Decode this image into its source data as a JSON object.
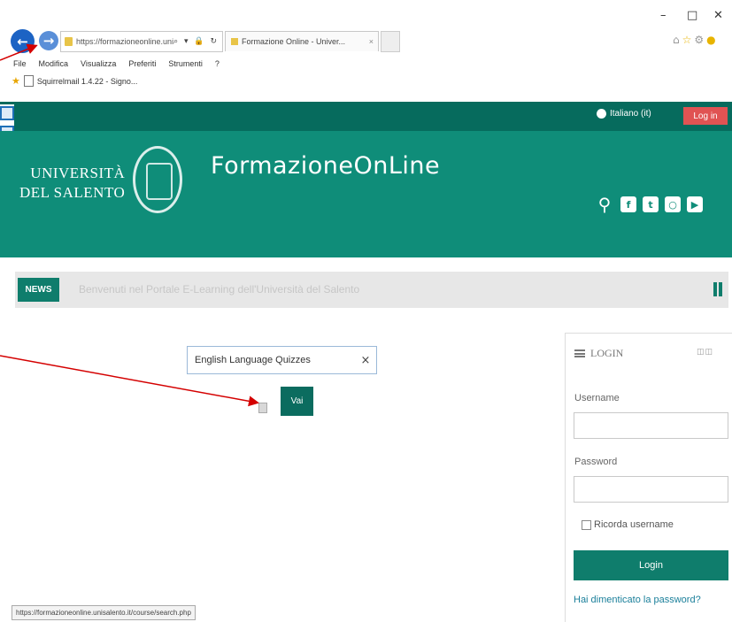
{
  "browser": {
    "address_url": "https://formazioneonline.unis...",
    "address_tools": "⌕ ▾ 🔒 ↻",
    "tab_title": "Formazione Online - Univer...",
    "tab_close": "×",
    "window_controls": [
      "–",
      "□",
      "✕"
    ],
    "menu": [
      "File",
      "Modifica",
      "Visualizza",
      "Preferiti",
      "Strumenti",
      "?"
    ],
    "favorite_link": "Squirrelmail 1.4.22 - Signo...",
    "status_url": "https://formazioneonline.unisalento.it/course/search.php"
  },
  "site": {
    "language": "Italiano (it)",
    "login_top": "Log in",
    "university_line1": "UNIVERSITÀ",
    "university_line2": "DEL SALENTO",
    "title": "FormazioneOnLine",
    "social_icons": [
      "search-icon",
      "facebook-icon",
      "twitter-icon",
      "instagram-icon",
      "youtube-icon"
    ]
  },
  "news": {
    "label": "NEWS",
    "text": "Benvenuti nel Portale E-Learning dell'Università del Salento"
  },
  "course_search": {
    "value": "English Language Quizzes",
    "clear": "×",
    "button": "Vai"
  },
  "login_block": {
    "title": "LOGIN",
    "username_label": "Username",
    "password_label": "Password",
    "remember_label": "Ricorda username",
    "submit_label": "Login",
    "forgot_label": "Hai dimenticato la password?"
  },
  "colors": {
    "brand_dark": "#066b5d",
    "brand": "#0f8d79",
    "button": "#0b6c5f",
    "login_red": "#e05353",
    "arrow": "#d40000"
  }
}
